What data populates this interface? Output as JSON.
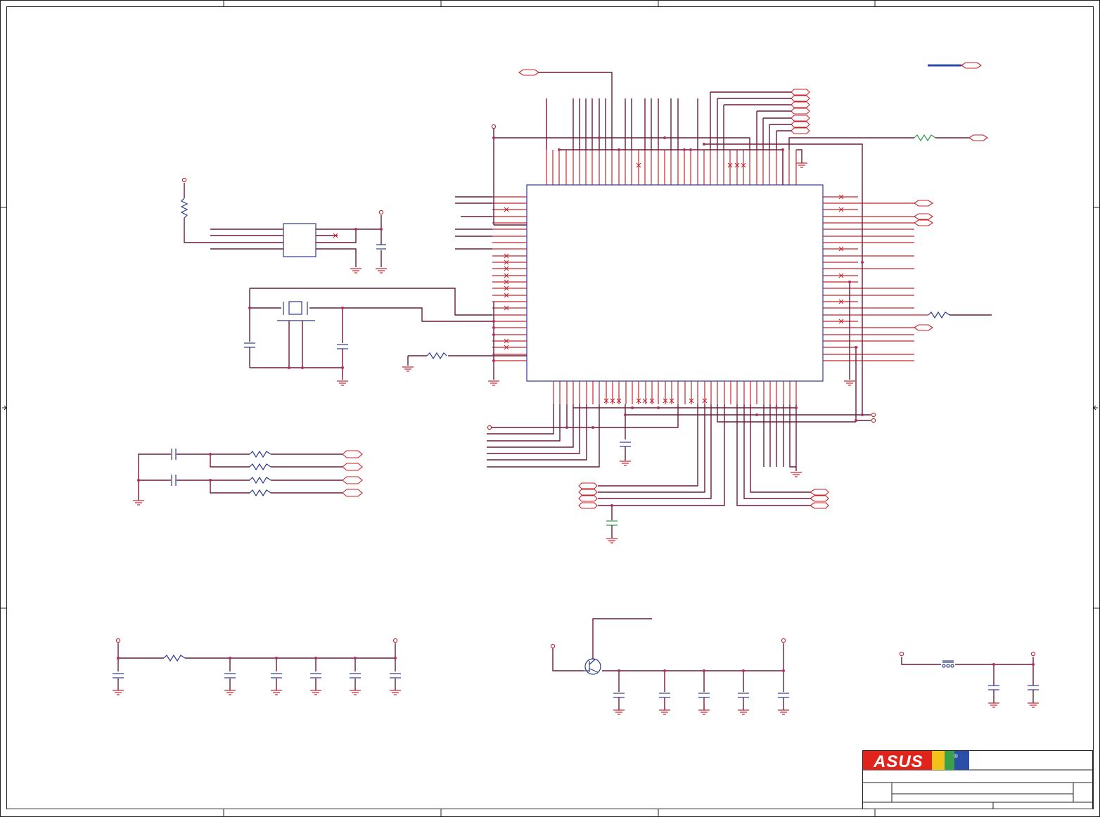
{
  "title_block": {
    "logo_text": "ASUS",
    "registered_mark": "®"
  },
  "colors": {
    "wire": "#6b1a3c",
    "pin": "#c8202a",
    "part": "#2d3a8c",
    "junction": "#b0306a",
    "bus": "#2a49a8",
    "logo_red": "#e0241b",
    "logo_blue": "#2b4fa8"
  },
  "icons": [
    "ground-symbol",
    "power-rail-symbol",
    "resistor-symbol",
    "capacitor-symbol",
    "crystal-symbol",
    "transistor-symbol",
    "inductor-symbol",
    "off-page-connector"
  ]
}
